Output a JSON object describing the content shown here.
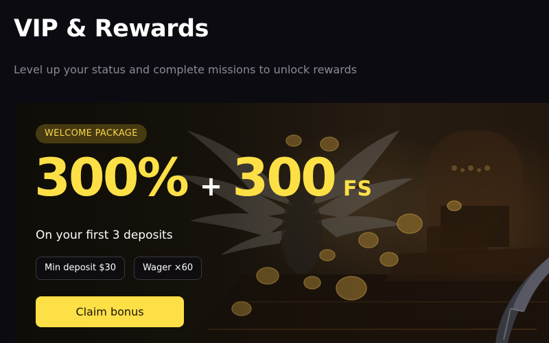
{
  "header": {
    "title": "VIP & Rewards",
    "subtitle": "Level up your status and complete missions to unlock rewards"
  },
  "promo": {
    "badge": "WELCOME PACKAGE",
    "bonus_percent": "300%",
    "plus": "+",
    "free_spins": "300",
    "free_spins_unit": "FS",
    "description": "On your first 3 deposits",
    "tags": {
      "min_deposit": "Min deposit $30",
      "wager": "Wager ×60"
    },
    "cta_label": "Claim bonus"
  },
  "colors": {
    "accent": "#fde046",
    "background": "#0c0b11",
    "subtitle": "#8b8996",
    "badge_text": "#f6d64a"
  },
  "icons": {
    "banner_art": "angel-wings-casino-illustration",
    "corner_blade": "dark-blade-ornament"
  }
}
